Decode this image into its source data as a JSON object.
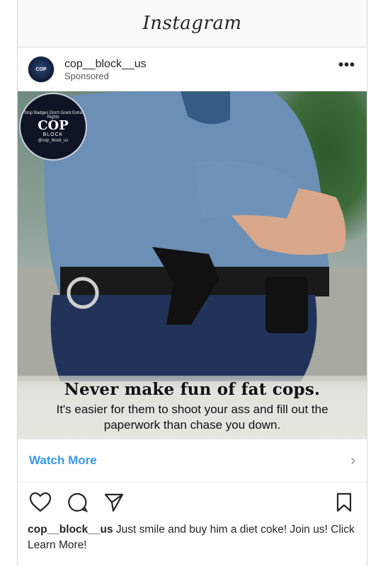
{
  "app": {
    "title": "Instagram"
  },
  "post": {
    "username": "cop__block__us",
    "sponsored": "Sponsored",
    "more_icon": "more-horizontal-icon",
    "media": {
      "badge_title": "COP",
      "badge_sub": "BLOCK",
      "badge_ring": "Stop Badges Don't Grant Extra Rights",
      "badge_handle": "@cop_block_us",
      "headline": "Never make fun of fat cops.",
      "subline": "It's easier for them to shoot your ass and fill out the paperwork than chase you down."
    },
    "cta": {
      "label": "Watch More",
      "chevron": "›"
    },
    "caption_user": "cop__block__us",
    "caption_text": " Just smile and buy him a diet coke! Join us! Click Learn More!"
  },
  "colors": {
    "accent": "#3897f0",
    "text": "#262626",
    "muted": "#8e8e8e"
  }
}
